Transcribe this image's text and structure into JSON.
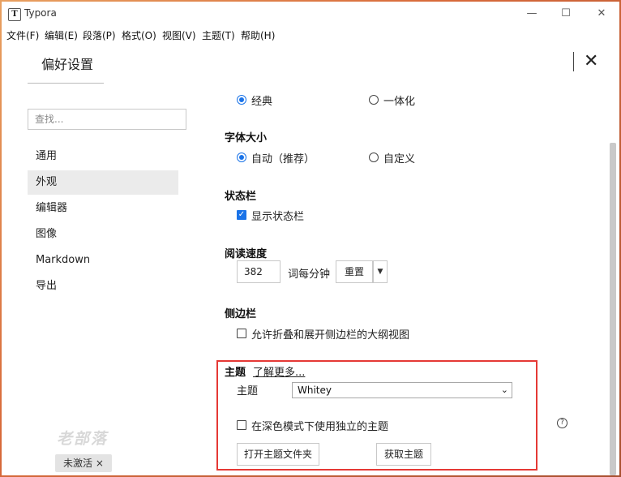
{
  "app": {
    "icon_letter": "T",
    "title": "Typora"
  },
  "window_controls": {
    "minimize": "—",
    "maximize": "☐",
    "close": "✕"
  },
  "menu": [
    "文件(F)",
    "编辑(E)",
    "段落(P)",
    "格式(O)",
    "视图(V)",
    "主题(T)",
    "帮助(H)"
  ],
  "preferences": {
    "title": "偏好设置",
    "close_glyph": "✕",
    "search_placeholder": "查找...",
    "nav": [
      {
        "label": "通用",
        "active": false
      },
      {
        "label": "外观",
        "active": true
      },
      {
        "label": "编辑器",
        "active": false
      },
      {
        "label": "图像",
        "active": false
      },
      {
        "label": "Markdown",
        "active": false
      },
      {
        "label": "导出",
        "active": false
      }
    ],
    "watermark": "老部落",
    "badge": "未激活 ×"
  },
  "appearance": {
    "window_style": {
      "classic": "经典",
      "unified": "一体化",
      "selected": "classic"
    },
    "font_size": {
      "heading": "字体大小",
      "auto": "自动（推荐）",
      "custom": "自定义",
      "selected": "auto"
    },
    "status_bar": {
      "heading": "状态栏",
      "show": "显示状态栏",
      "checked": true
    },
    "reading_speed": {
      "heading": "阅读速度",
      "value": "382",
      "unit": "词每分钟",
      "reset": "重置",
      "arrow": "▼"
    },
    "sidebar": {
      "heading": "侧边栏",
      "allow_fold": "允许折叠和展开侧边栏的大纲视图",
      "checked": false
    },
    "theme": {
      "heading": "主题",
      "learn_more": "了解更多...",
      "select_label": "主题",
      "selected": "Whitey",
      "chevron": "⌄",
      "dark_mode": "在深色模式下使用独立的主题",
      "dark_checked": false,
      "help": "?",
      "open_folder": "打开主题文件夹",
      "get_themes": "获取主题"
    }
  },
  "colors": {
    "accent": "#1a73e8",
    "highlight_border": "#e53935"
  }
}
